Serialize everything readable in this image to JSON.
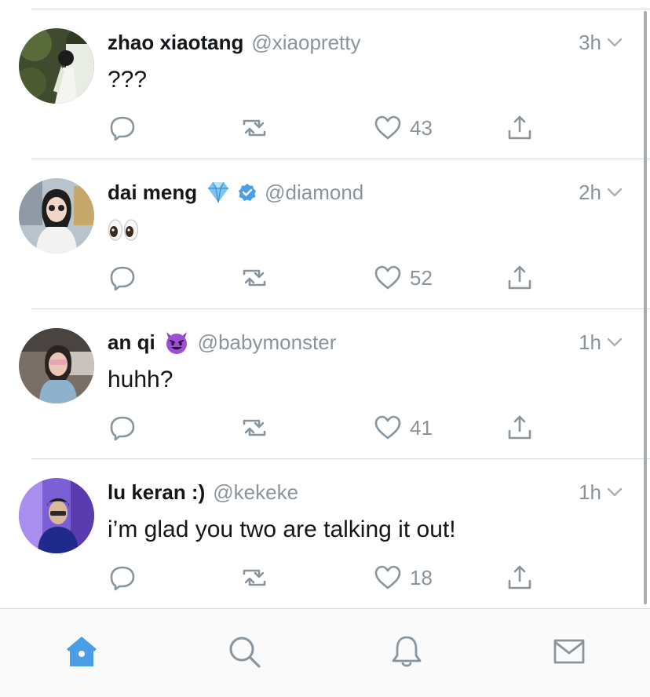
{
  "tweets": [
    {
      "name": "zhao xiaotang",
      "handle": "@xiaopretty",
      "time": "3h",
      "text": "???",
      "likes": "43",
      "badges": []
    },
    {
      "name": "dai meng",
      "handle": "@diamond",
      "time": "2h",
      "text": "",
      "text_emoji": "eyes",
      "likes": "52",
      "badges": [
        "gem-emoji",
        "verified-badge"
      ]
    },
    {
      "name": "an qi",
      "handle": "@babymonster",
      "time": "1h",
      "text": "huhh?",
      "likes": "41",
      "badges": [
        "smiling-devil-emoji"
      ]
    },
    {
      "name": "lu keran :)",
      "handle": "@kekeke",
      "time": "1h",
      "text": "i’m glad you two are talking it out!",
      "likes": "18",
      "badges": []
    }
  ],
  "tabbar": {
    "items": [
      "home-icon",
      "search-icon",
      "notifications-icon",
      "messages-icon"
    ],
    "active": "home-icon"
  },
  "colors": {
    "accent": "#4a9ee6",
    "muted": "#8a949d",
    "text": "#14171a",
    "separator": "#cfd6dc",
    "verified": "#4a9ee6"
  }
}
